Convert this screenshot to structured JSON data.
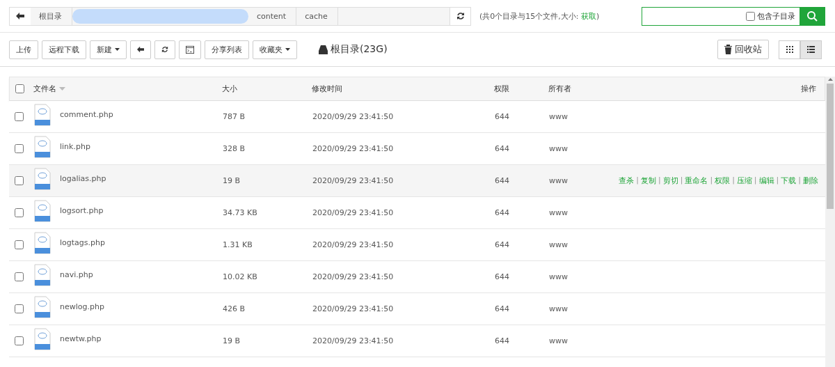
{
  "path_bar": {
    "crumbs": [
      {
        "label": "根目录",
        "kind": "text"
      },
      {
        "kind": "redacted"
      },
      {
        "label": "content",
        "kind": "text"
      },
      {
        "label": "cache",
        "kind": "text"
      }
    ]
  },
  "summary": {
    "text": "(共0个目录与15个文件,大小: ",
    "link": "获取",
    "end": ")"
  },
  "search": {
    "include_subdirs": {
      "label": "包含子目录",
      "checked": false
    }
  },
  "toolbar": {
    "buttons": [
      {
        "label": "上传",
        "kind": "text"
      },
      {
        "label": "远程下载",
        "kind": "text"
      },
      {
        "label": "新建",
        "kind": "dropdown"
      },
      {
        "kind": "back"
      },
      {
        "kind": "refresh"
      },
      {
        "kind": "terminal"
      },
      {
        "label": "分享列表",
        "kind": "text"
      },
      {
        "label": "收藏夹",
        "kind": "dropdown"
      }
    ],
    "disk": "根目录(23G)",
    "recycle": "回收站",
    "views": [
      {
        "kind": "grid",
        "selected": false
      },
      {
        "kind": "list",
        "selected": true
      }
    ]
  },
  "table": {
    "columns": [
      "文件名",
      "大小",
      "修改时间",
      "权限",
      "所有者",
      "操作"
    ],
    "all_checked": false,
    "action_separator": "|",
    "actions": [
      "查杀",
      "复制",
      "剪切",
      "重命名",
      "权限",
      "压缩",
      "编辑",
      "下载",
      "删除"
    ],
    "rows": [
      {
        "name": "comment.php",
        "size": "787 B",
        "mtime": "2020/09/29 23:41:50",
        "perm": "644",
        "owner": "www",
        "checked": false,
        "hovered": false
      },
      {
        "name": "link.php",
        "size": "328 B",
        "mtime": "2020/09/29 23:41:50",
        "perm": "644",
        "owner": "www",
        "checked": false,
        "hovered": false
      },
      {
        "name": "logalias.php",
        "size": "19 B",
        "mtime": "2020/09/29 23:41:50",
        "perm": "644",
        "owner": "www",
        "checked": false,
        "hovered": true
      },
      {
        "name": "logsort.php",
        "size": "34.73 KB",
        "mtime": "2020/09/29 23:41:50",
        "perm": "644",
        "owner": "www",
        "checked": false,
        "hovered": false
      },
      {
        "name": "logtags.php",
        "size": "1.31 KB",
        "mtime": "2020/09/29 23:41:50",
        "perm": "644",
        "owner": "www",
        "checked": false,
        "hovered": false
      },
      {
        "name": "navi.php",
        "size": "10.02 KB",
        "mtime": "2020/09/29 23:41:50",
        "perm": "644",
        "owner": "www",
        "checked": false,
        "hovered": false
      },
      {
        "name": "newlog.php",
        "size": "426 B",
        "mtime": "2020/09/29 23:41:50",
        "perm": "644",
        "owner": "www",
        "checked": false,
        "hovered": false
      },
      {
        "name": "newtw.php",
        "size": "19 B",
        "mtime": "2020/09/29 23:41:50",
        "perm": "644",
        "owner": "www",
        "checked": false,
        "hovered": false
      }
    ]
  }
}
